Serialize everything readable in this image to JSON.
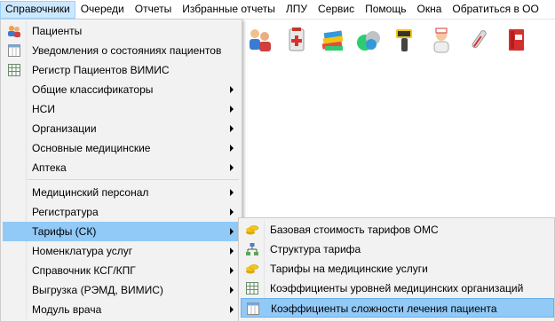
{
  "menubar": {
    "items": [
      {
        "label": "Справочники",
        "active": true
      },
      {
        "label": "Очереди"
      },
      {
        "label": "Отчеты"
      },
      {
        "label": "Избранные отчеты"
      },
      {
        "label": "ЛПУ"
      },
      {
        "label": "Сервис"
      },
      {
        "label": "Помощь"
      },
      {
        "label": "Окна"
      },
      {
        "label": "Обратиться в ОО"
      }
    ]
  },
  "toolbar": {
    "icons": [
      "patients-toolbar-icon",
      "medical-kit-icon",
      "books-icon",
      "pills-icon",
      "barcode-scanner-icon",
      "nurse-icon",
      "thermometer-icon",
      "book-red-icon"
    ]
  },
  "dropdown": {
    "items": [
      {
        "label": "Пациенты",
        "icon": "patients-icon"
      },
      {
        "label": "Уведомления о состояниях пациентов",
        "icon": "calendar-icon"
      },
      {
        "label": "Регистр Пациентов ВИМИС",
        "icon": "table-icon"
      },
      {
        "label": "Общие классификаторы",
        "submenu": true
      },
      {
        "label": "НСИ",
        "submenu": true
      },
      {
        "label": "Организации",
        "submenu": true
      },
      {
        "label": "Основные медицинские",
        "submenu": true
      },
      {
        "label": "Аптека",
        "submenu": true
      },
      {
        "label": "Медицинский персонал",
        "submenu": true
      },
      {
        "label": "Регистратура",
        "submenu": true
      },
      {
        "label": "Тарифы (СК)",
        "submenu": true,
        "highlighted": true
      },
      {
        "label": "Номенклатура услуг",
        "submenu": true
      },
      {
        "label": "Справочник КСГ/КПГ",
        "submenu": true
      },
      {
        "label": "Выгрузка (РЭМД, ВИМИС)",
        "submenu": true
      },
      {
        "label": "Модуль врача",
        "submenu": true
      }
    ]
  },
  "submenu": {
    "items": [
      {
        "label": "Базовая стоимость тарифов ОМС",
        "icon": "coins-icon"
      },
      {
        "label": "Структура тарифа",
        "icon": "structure-icon"
      },
      {
        "label": "Тарифы на медицинские услуги",
        "icon": "coins-icon"
      },
      {
        "label": "Коэффициенты уровней медицинских организаций",
        "icon": "table-icon"
      },
      {
        "label": "Коэффициенты сложности лечения пациента",
        "icon": "calendar-icon",
        "highlighted": true
      }
    ]
  },
  "colors": {
    "menu_bg": "#f2f2f2",
    "highlight": "#91c9f7",
    "menubar_active": "#cce8ff"
  }
}
